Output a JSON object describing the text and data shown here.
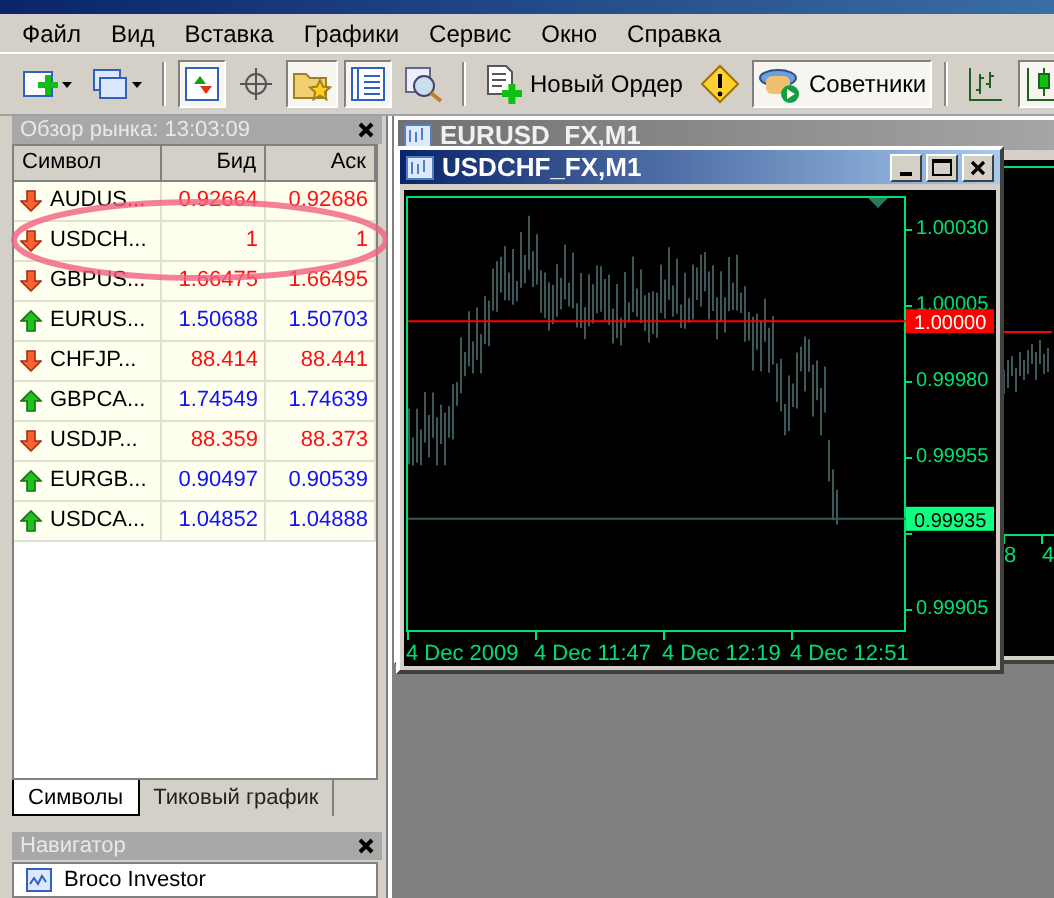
{
  "menu": [
    "Файл",
    "Вид",
    "Вставка",
    "Графики",
    "Сервис",
    "Окно",
    "Справка"
  ],
  "toolbar": [
    {
      "kind": "new-chart",
      "pressed": false
    },
    {
      "kind": "profiles",
      "pressed": false
    },
    {
      "kind": "separator"
    },
    {
      "kind": "market-watch",
      "pressed": true
    },
    {
      "kind": "crosshair",
      "pressed": false
    },
    {
      "kind": "navigator",
      "pressed": true
    },
    {
      "kind": "terminal",
      "pressed": true
    },
    {
      "kind": "tester",
      "pressed": false
    },
    {
      "kind": "separator"
    },
    {
      "kind": "new-order",
      "label": "Новый Ордер",
      "pressed": false
    },
    {
      "kind": "alert",
      "pressed": false
    },
    {
      "kind": "experts",
      "label": "Советники",
      "pressed": true
    },
    {
      "kind": "separator"
    },
    {
      "kind": "bar-chart",
      "pressed": false
    },
    {
      "kind": "candle-chart",
      "pressed": true
    }
  ],
  "market_watch": {
    "title": "Обзор рынка: 13:03:09",
    "columns": [
      "Символ",
      "Бид",
      "Аск"
    ],
    "rows": [
      {
        "symbol": "AUDUS...",
        "bid": "0.92664",
        "ask": "0.92686",
        "kind": "down",
        "circled": false
      },
      {
        "symbol": "USDCH...",
        "bid": "1",
        "ask": "1",
        "kind": "down",
        "circled": true
      },
      {
        "symbol": "GBPUS...",
        "bid": "1.66475",
        "ask": "1.66495",
        "kind": "down",
        "circled": false
      },
      {
        "symbol": "EURUS...",
        "bid": "1.50688",
        "ask": "1.50703",
        "kind": "up",
        "circled": false
      },
      {
        "symbol": "CHFJP...",
        "bid": "88.414",
        "ask": "88.441",
        "kind": "down",
        "circled": false
      },
      {
        "symbol": "GBPCA...",
        "bid": "1.74549",
        "ask": "1.74639",
        "kind": "up",
        "circled": false
      },
      {
        "symbol": "USDJP...",
        "bid": "88.359",
        "ask": "88.373",
        "kind": "down",
        "circled": false
      },
      {
        "symbol": "EURGB...",
        "bid": "0.90497",
        "ask": "0.90539",
        "kind": "up",
        "circled": false
      },
      {
        "symbol": "USDCA...",
        "bid": "1.04852",
        "ask": "1.04888",
        "kind": "up",
        "circled": false
      }
    ]
  },
  "tabs": [
    {
      "label": "Символы",
      "selected": true
    },
    {
      "label": "Тиковый график",
      "selected": false
    }
  ],
  "navigator": {
    "title": "Навигатор",
    "items": [
      "Broco Investor"
    ]
  },
  "charts": [
    {
      "title": "EURUSD_FX,M1",
      "active": false,
      "time_labels": [
        "8",
        "4"
      ]
    },
    {
      "title": "USDCHF_FX,M1",
      "active": true,
      "price_labels": [
        "1.00030",
        "1.00005",
        "0.99980",
        "0.99955",
        "0.99905"
      ],
      "bid_label": "1.00000",
      "ask_label": "0.99935",
      "time_labels": [
        "4 Dec 2009",
        "4 Dec 11:47",
        "4 Dec 12:19",
        "4 Dec 12:51"
      ]
    }
  ]
}
